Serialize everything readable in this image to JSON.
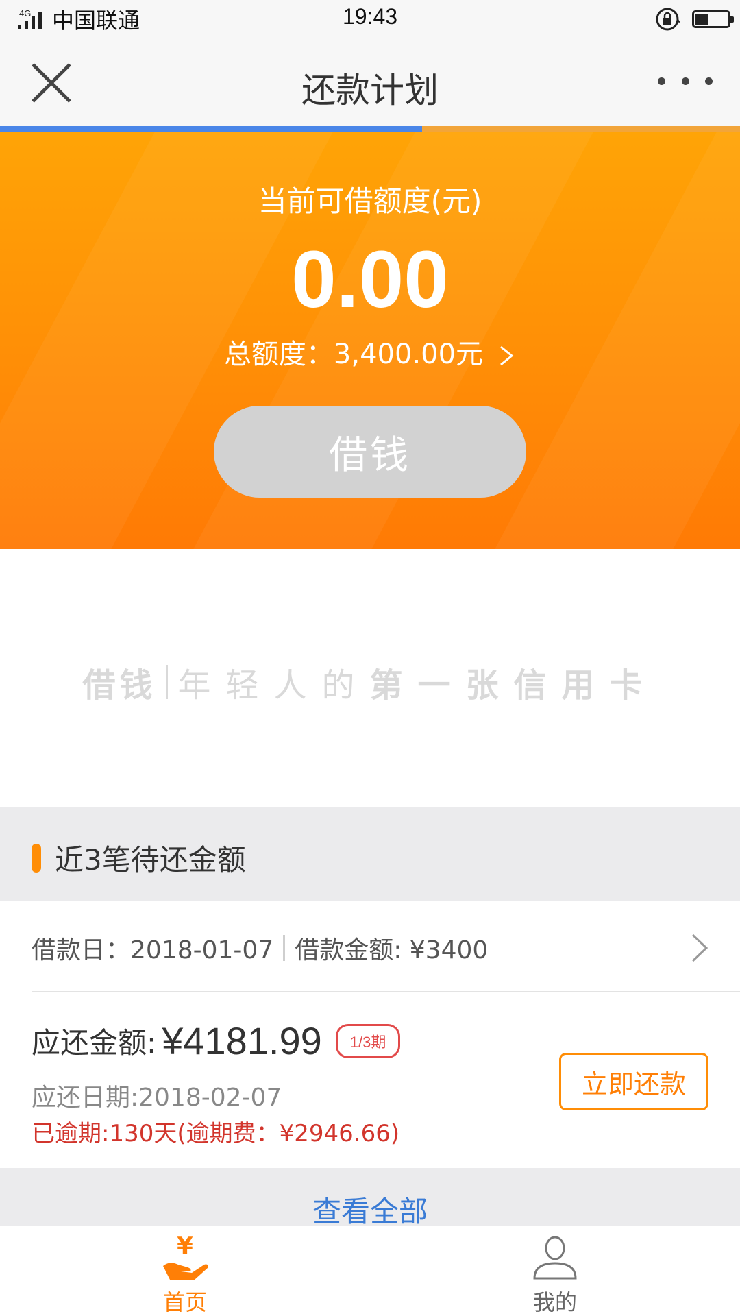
{
  "status_bar": {
    "network": "4G",
    "carrier": "中国联通",
    "time": "19:43",
    "battery_level": 0.45
  },
  "nav": {
    "title": "还款计划",
    "close_icon": "close-icon",
    "more_icon": "more-dots-icon",
    "load_progress": 0.57
  },
  "hero": {
    "label": "当前可借额度(元)",
    "amount": "0.00",
    "total": "总额度：3,400.00元",
    "borrow_button": "借钱"
  },
  "slogan": {
    "lead": "借钱",
    "part1": "年轻人的",
    "part2": "第一张信用卡"
  },
  "section": {
    "title": "近3笔待还金额"
  },
  "loan": {
    "date_text": "借款日：2018-01-07",
    "amount_text": "借款金额: ¥3400"
  },
  "payment": {
    "amount_label": "应还金额:",
    "amount_value": "¥4181.99",
    "period_badge": "1/3期",
    "due_date": "应还日期:2018-02-07",
    "overdue": "已逾期:130天(逾期费：¥2946.66)",
    "pay_button": "立即还款"
  },
  "view_all": "查看全部",
  "tabs": [
    {
      "label": "首页",
      "icon": "yen-hand-icon",
      "active": true
    },
    {
      "label": "我的",
      "icon": "user-icon",
      "active": false
    }
  ],
  "colors": {
    "accent": "#ff8d06",
    "link": "#3a7bd5",
    "danger": "#d2352c",
    "progress": "#4a86e8"
  }
}
